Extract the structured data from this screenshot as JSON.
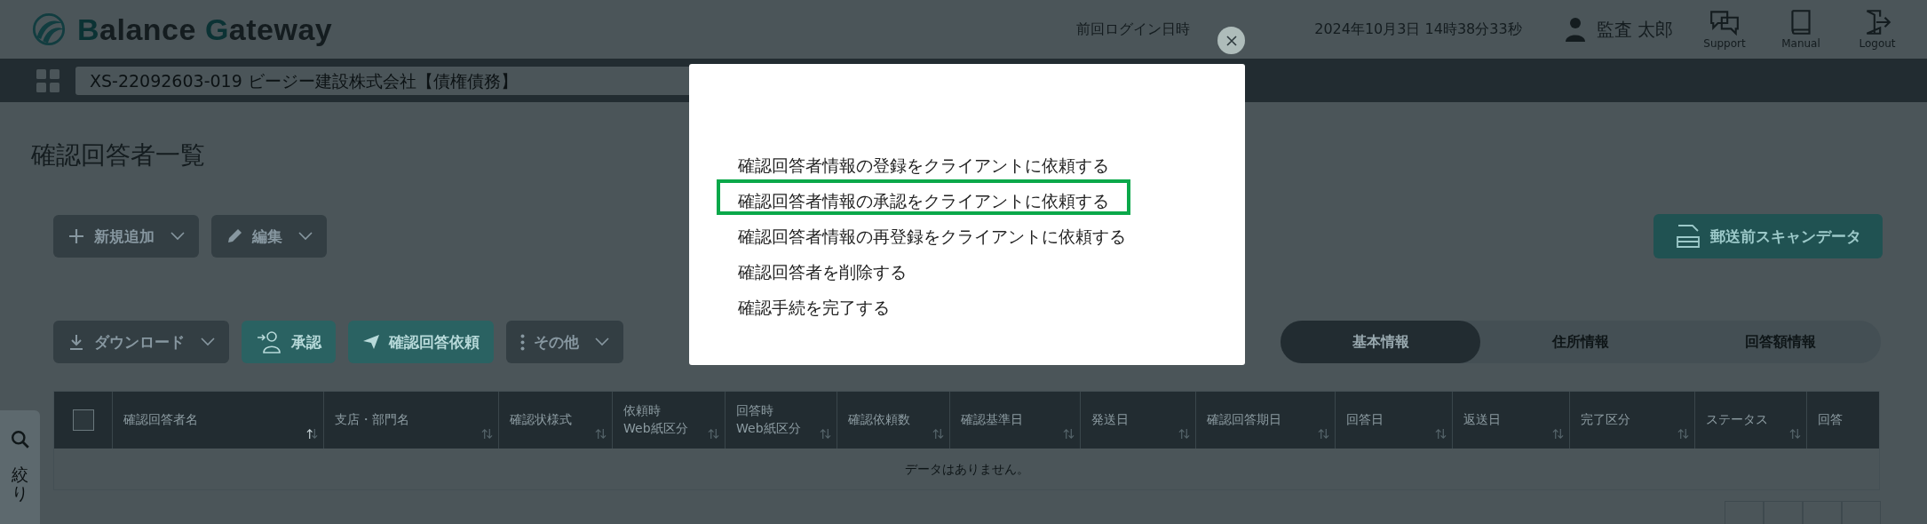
{
  "header": {
    "logo_words": [
      {
        "initial": "B",
        "rest": "alance"
      },
      {
        "initial": "G",
        "rest": "ateway"
      }
    ],
    "last_login_label": "前回ログイン日時",
    "last_login_value": "2024年10月3日 14時38分33秒",
    "user_name": "監査 太郎",
    "links": [
      {
        "label": "Support"
      },
      {
        "label": "Manual"
      },
      {
        "label": "Logout"
      }
    ]
  },
  "project_bar": {
    "project": "XS-22092603-019 ビージー建設株式会社【債権債務】"
  },
  "page_title": "確認回答者一覧",
  "toolbar_top": [
    {
      "label": "新規追加",
      "kind": "default",
      "dropdown": true
    },
    {
      "label": "編集",
      "kind": "default",
      "dropdown": true
    }
  ],
  "scan_button": {
    "label": "郵送前スキャンデータ"
  },
  "toolbar_bottom": [
    {
      "label": "ダウンロード",
      "kind": "default",
      "dropdown": true
    },
    {
      "label": "承認",
      "kind": "primary",
      "dropdown": false
    },
    {
      "label": "確認回答依頼",
      "kind": "primary",
      "dropdown": false
    },
    {
      "label": "その他",
      "kind": "default",
      "dropdown": true
    }
  ],
  "tabs": [
    {
      "label": "基本情報",
      "selected": true
    },
    {
      "label": "住所情報",
      "selected": false
    },
    {
      "label": "回答額情報",
      "selected": false
    }
  ],
  "table": {
    "select_all_checked": false,
    "columns": [
      {
        "label": "確認回答者名",
        "sortable": true,
        "sorted": true
      },
      {
        "label": "支店・部門名",
        "sortable": true,
        "sorted": false
      },
      {
        "label": "確認状様式",
        "sortable": true,
        "sorted": false
      },
      {
        "label": "依頼時\nWeb紙区分",
        "sortable": true,
        "sorted": false
      },
      {
        "label": "回答時\nWeb紙区分",
        "sortable": true,
        "sorted": false
      },
      {
        "label": "確認依頼数",
        "sortable": true,
        "sorted": false
      },
      {
        "label": "確認基準日",
        "sortable": true,
        "sorted": false
      },
      {
        "label": "発送日",
        "sortable": true,
        "sorted": false
      },
      {
        "label": "確認回答期日",
        "sortable": true,
        "sorted": false
      },
      {
        "label": "回答日",
        "sortable": true,
        "sorted": false
      },
      {
        "label": "返送日",
        "sortable": true,
        "sorted": false
      },
      {
        "label": "完了区分",
        "sortable": true,
        "sorted": false
      },
      {
        "label": "ステータス",
        "sortable": true,
        "sorted": false
      },
      {
        "label": "回答",
        "sortable": false
      }
    ],
    "empty_message": "データはありません。"
  },
  "filter_tab": {
    "label": "絞り"
  },
  "modal": {
    "items": [
      {
        "label": "確認回答者情報の登録をクライアントに依頼する",
        "selected": false
      },
      {
        "label": "確認回答者情報の承認をクライアントに依頼する",
        "selected": true
      },
      {
        "label": "確認回答者情報の再登録をクライアントに依頼する",
        "selected": false
      },
      {
        "label": "確認回答者を削除する",
        "selected": false
      },
      {
        "label": "確認手続を完了する",
        "selected": false
      }
    ]
  }
}
